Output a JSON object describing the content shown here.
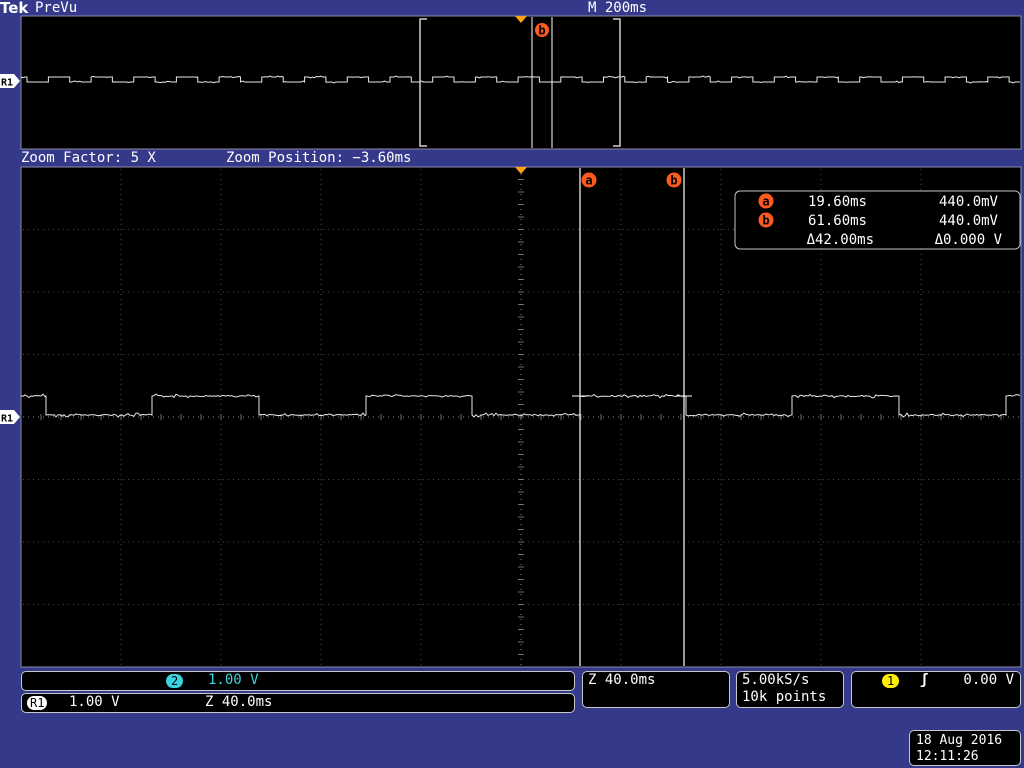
{
  "header": {
    "brand": "Tek",
    "mode": "PreVu",
    "timebase": "M 200ms"
  },
  "zoom": {
    "factor": "Zoom Factor: 5 X",
    "position": "Zoom Position: −3.60ms"
  },
  "markers": {
    "ref_label": "R1",
    "cursor_a": "a",
    "cursor_b": "b"
  },
  "cursor_readout": {
    "a_time": "19.60ms",
    "a_volt": "440.0mV",
    "b_time": "61.60ms",
    "b_volt": "440.0mV",
    "delta_time": "Δ42.00ms",
    "delta_volt": "Δ0.000 V"
  },
  "channel_panel": {
    "ch2_badge": "2",
    "ch2_scale": "1.00 V",
    "ref_badge": "R1",
    "ref_scale": "1.00 V",
    "ref_zoom": "Z 40.0ms"
  },
  "zoom_panel": {
    "text": "Z 40.0ms"
  },
  "acq_panel": {
    "rate": "5.00kS/s",
    "points": "10k points"
  },
  "trigger_panel": {
    "source_badge": "1",
    "slope_symbol": "ʃ",
    "level": "0.00 V"
  },
  "datetime": {
    "date": "18 Aug 2016",
    "time": "12:11:26"
  },
  "colors": {
    "frame_bg": "#35398a",
    "screen_bg": "#000000",
    "trace": "#e8e8e8",
    "cursor_marker": "#ff5a1e",
    "trigger_marker": "#ff9f1a",
    "ch2": "#3ad3e0",
    "ch1": "#ffee00"
  }
}
